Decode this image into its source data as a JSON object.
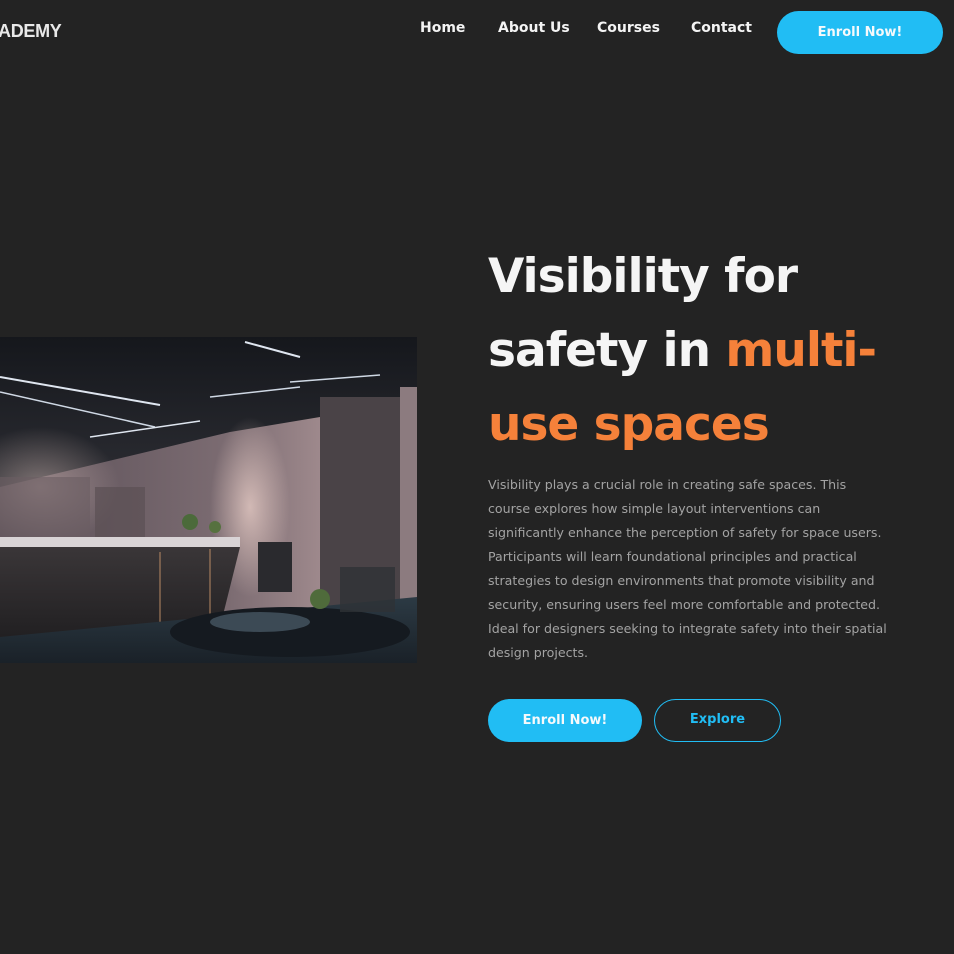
{
  "brand": {
    "logo_text": "ADEMY"
  },
  "nav": {
    "links": [
      {
        "label": "Home"
      },
      {
        "label": "About Us"
      },
      {
        "label": "Courses"
      },
      {
        "label": "Contact"
      }
    ],
    "cta_label": "Enroll Now!"
  },
  "hero": {
    "title_line1": "Visibility for",
    "title_line2_plain": "safety in ",
    "title_line2_accent": "multi-",
    "title_line3_accent": "use spaces",
    "description": "Visibility plays a crucial role in creating safe spaces. This course explores how simple layout interventions can significantly enhance the perception of safety for space users. Participants will learn foundational principles and practical strategies to design environments that promote visibility and security, ensuring users feel more comfortable and protected. Ideal for designers seeking to integrate safety into their spatial design projects.",
    "primary_button": "Enroll Now!",
    "secondary_button": "Explore"
  },
  "colors": {
    "background": "#232323",
    "accent_blue": "#21bdf4",
    "accent_orange": "#f5813a"
  }
}
